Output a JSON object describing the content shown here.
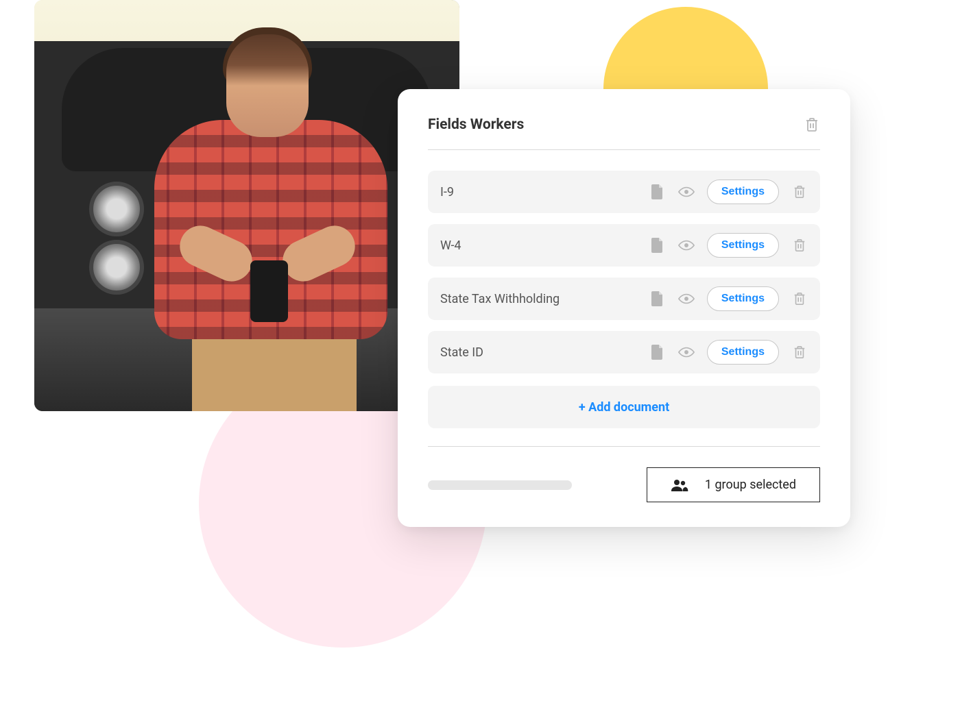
{
  "panel": {
    "title": "Fields Workers",
    "settings_label": "Settings",
    "add_document_label": "+ Add document",
    "group_selected_label": "1 group selected",
    "documents": [
      {
        "name": "I-9"
      },
      {
        "name": "W-4"
      },
      {
        "name": "State Tax Withholding"
      },
      {
        "name": "State ID"
      }
    ]
  },
  "colors": {
    "accent": "#1a8cff",
    "yellow": "#ffd95c",
    "pink": "#ffe9f0"
  }
}
